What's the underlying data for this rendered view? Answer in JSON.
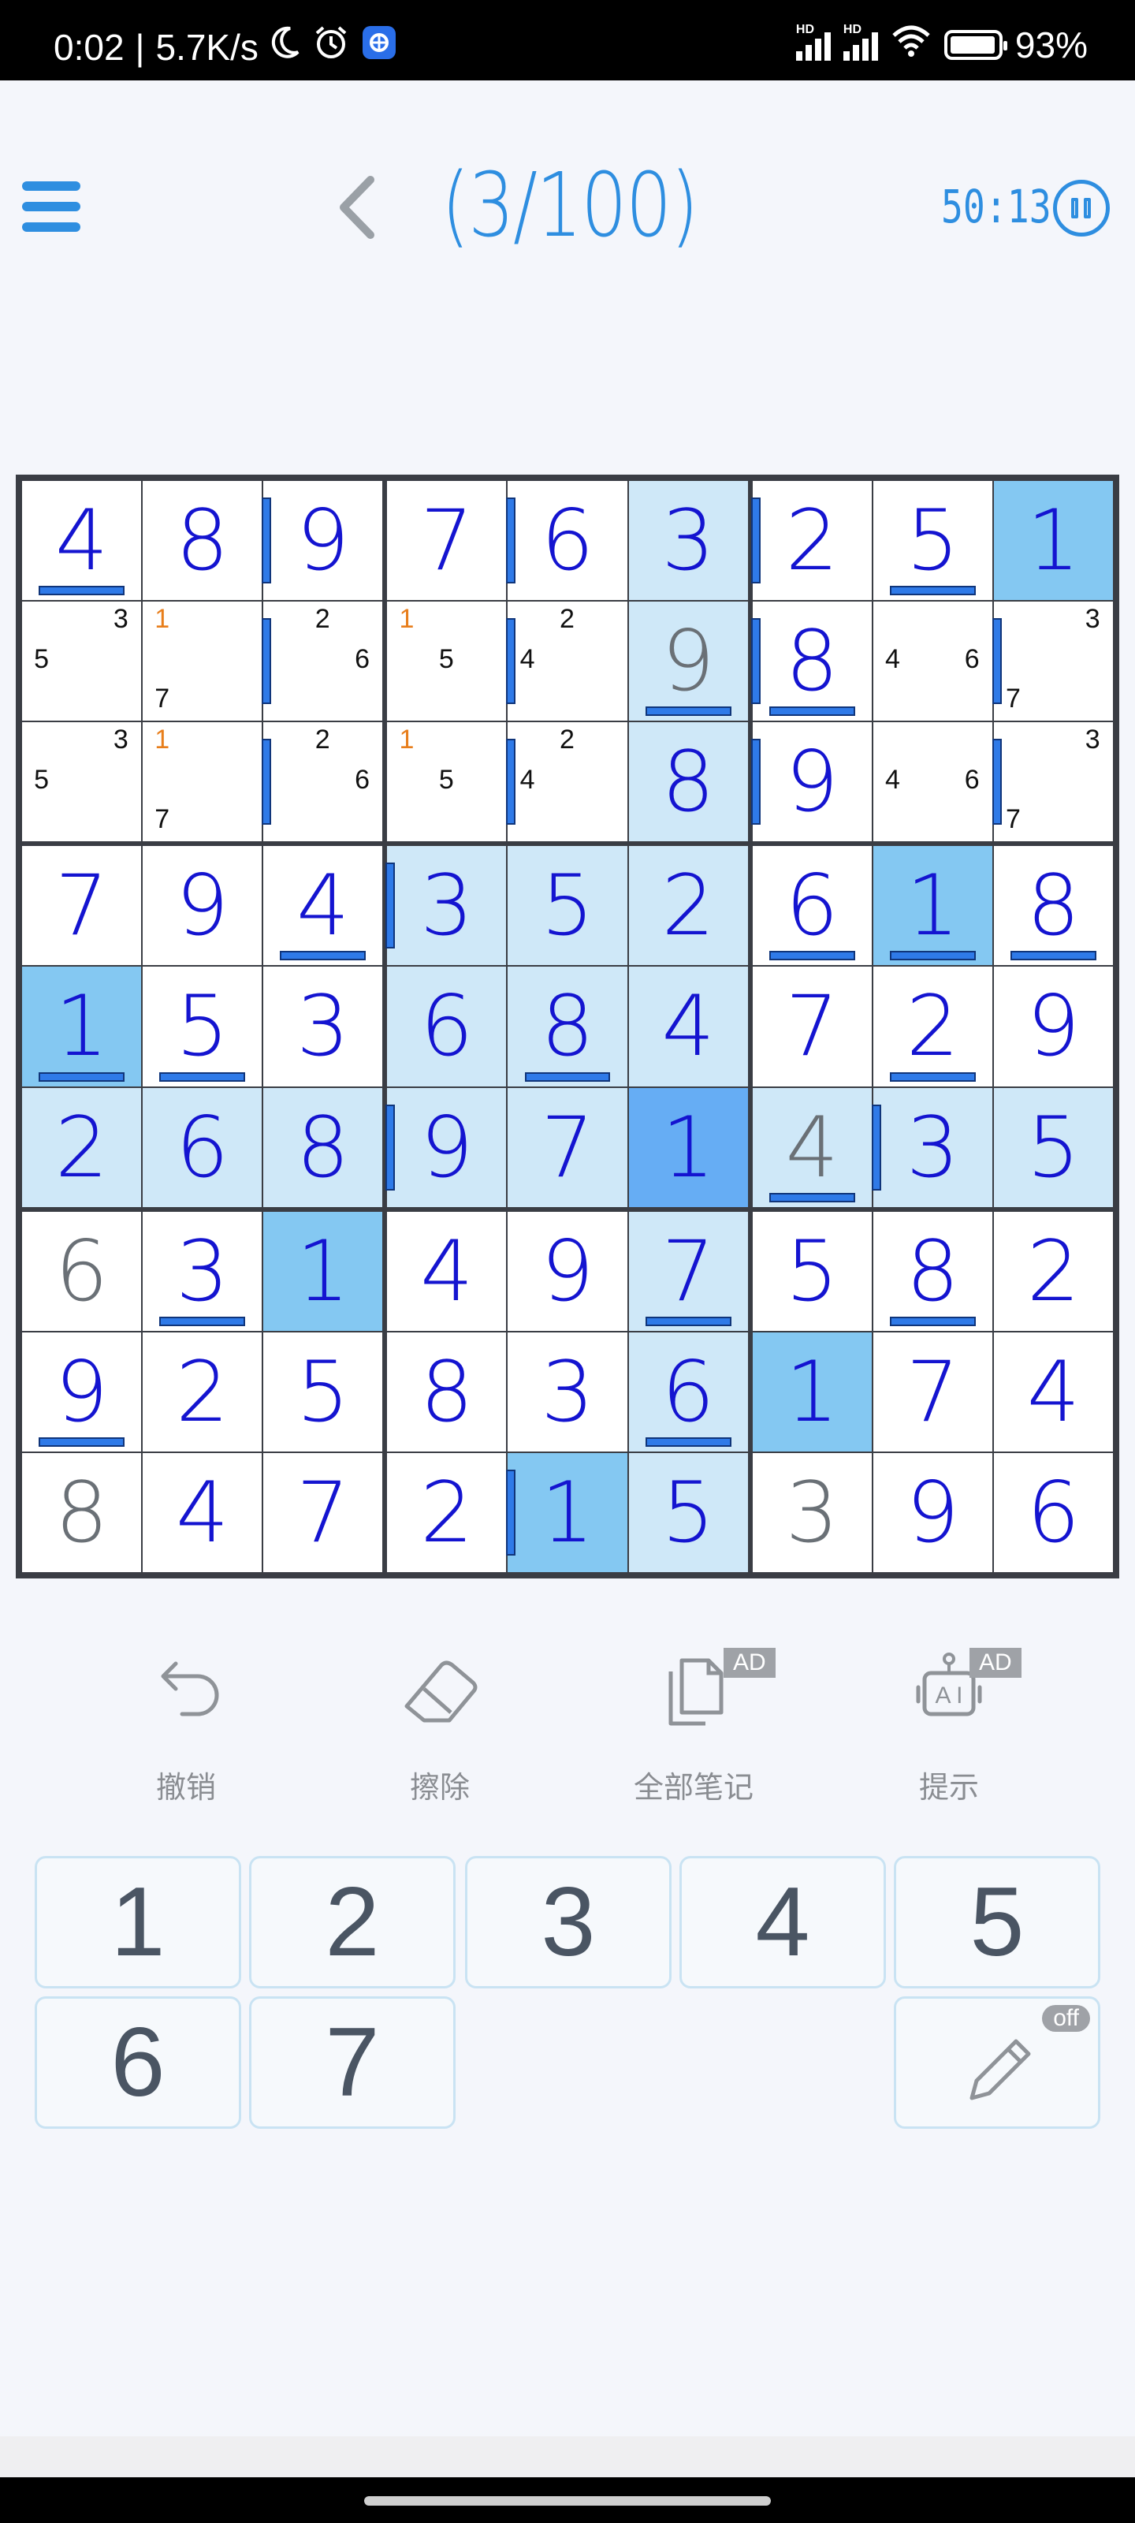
{
  "status_bar": {
    "time": "0:02",
    "net_speed": "5.7K/s",
    "battery": "93%",
    "signal_tag": "HD"
  },
  "header": {
    "title": "(3/100)",
    "timer": "50:13"
  },
  "colors": {
    "accent": "#2e8ee0",
    "user_digit": "#1414d0",
    "given_digit": "#6a7076",
    "highlight": "#cfe8f8",
    "same_number": "#84c8f2",
    "selected": "#66adf4",
    "note_orange": "#e87e1b"
  },
  "board": {
    "cells": [
      [
        "4",
        "8",
        "9",
        "7",
        "6",
        "3",
        "2",
        "5",
        "1"
      ],
      [
        "",
        "",
        "",
        "",
        "",
        "9",
        "8",
        "",
        ""
      ],
      [
        "",
        "",
        "",
        "",
        "",
        "8",
        "9",
        "",
        ""
      ],
      [
        "7",
        "9",
        "4",
        "3",
        "5",
        "2",
        "6",
        "1",
        "8"
      ],
      [
        "1",
        "5",
        "3",
        "6",
        "8",
        "4",
        "7",
        "2",
        "9"
      ],
      [
        "2",
        "6",
        "8",
        "9",
        "7",
        "1",
        "4",
        "3",
        "5"
      ],
      [
        "6",
        "3",
        "1",
        "4",
        "9",
        "7",
        "5",
        "8",
        "2"
      ],
      [
        "9",
        "2",
        "5",
        "8",
        "3",
        "6",
        "1",
        "7",
        "4"
      ],
      [
        "8",
        "4",
        "7",
        "2",
        "1",
        "5",
        "3",
        "9",
        "6"
      ]
    ],
    "given": [
      [
        1,
        5
      ],
      [
        5,
        6
      ],
      [
        6,
        0
      ],
      [
        8,
        0
      ],
      [
        8,
        6
      ]
    ],
    "highlight": [
      [
        0,
        5
      ],
      [
        1,
        5
      ],
      [
        2,
        5
      ],
      [
        3,
        3
      ],
      [
        3,
        4
      ],
      [
        3,
        5
      ],
      [
        4,
        3
      ],
      [
        4,
        4
      ],
      [
        4,
        5
      ],
      [
        5,
        0
      ],
      [
        5,
        1
      ],
      [
        5,
        2
      ],
      [
        5,
        3
      ],
      [
        5,
        4
      ],
      [
        5,
        6
      ],
      [
        5,
        7
      ],
      [
        5,
        8
      ],
      [
        6,
        5
      ],
      [
        7,
        5
      ],
      [
        8,
        5
      ]
    ],
    "same_number": [
      [
        0,
        8
      ],
      [
        3,
        7
      ],
      [
        4,
        0
      ],
      [
        6,
        2
      ],
      [
        7,
        6
      ],
      [
        8,
        4
      ]
    ],
    "selected": [
      5,
      5
    ],
    "notes": [
      {
        "r": 1,
        "c": 0,
        "items": [
          {
            "d": "3",
            "p": "tr"
          },
          {
            "d": "5",
            "p": "ml"
          }
        ]
      },
      {
        "r": 1,
        "c": 1,
        "items": [
          {
            "d": "1",
            "p": "tl",
            "o": true
          },
          {
            "d": "7",
            "p": "bl"
          }
        ]
      },
      {
        "r": 1,
        "c": 2,
        "items": [
          {
            "d": "2",
            "p": "tm"
          },
          {
            "d": "6",
            "p": "mr"
          }
        ]
      },
      {
        "r": 1,
        "c": 3,
        "items": [
          {
            "d": "1",
            "p": "tl",
            "o": true
          },
          {
            "d": "5",
            "p": "mm"
          }
        ]
      },
      {
        "r": 1,
        "c": 4,
        "items": [
          {
            "d": "2",
            "p": "tm"
          },
          {
            "d": "4",
            "p": "ml"
          }
        ]
      },
      {
        "r": 1,
        "c": 7,
        "items": [
          {
            "d": "4",
            "p": "ml"
          },
          {
            "d": "6",
            "p": "mr"
          }
        ]
      },
      {
        "r": 1,
        "c": 8,
        "items": [
          {
            "d": "3",
            "p": "tr"
          },
          {
            "d": "7",
            "p": "bl"
          }
        ]
      },
      {
        "r": 2,
        "c": 0,
        "items": [
          {
            "d": "3",
            "p": "tr"
          },
          {
            "d": "5",
            "p": "ml"
          }
        ]
      },
      {
        "r": 2,
        "c": 1,
        "items": [
          {
            "d": "1",
            "p": "tl",
            "o": true
          },
          {
            "d": "7",
            "p": "bl"
          }
        ]
      },
      {
        "r": 2,
        "c": 2,
        "items": [
          {
            "d": "2",
            "p": "tm"
          },
          {
            "d": "6",
            "p": "mr"
          }
        ]
      },
      {
        "r": 2,
        "c": 3,
        "items": [
          {
            "d": "1",
            "p": "tl",
            "o": true
          },
          {
            "d": "5",
            "p": "mm"
          }
        ]
      },
      {
        "r": 2,
        "c": 4,
        "items": [
          {
            "d": "2",
            "p": "tm"
          },
          {
            "d": "4",
            "p": "ml"
          }
        ]
      },
      {
        "r": 2,
        "c": 7,
        "items": [
          {
            "d": "4",
            "p": "ml"
          },
          {
            "d": "6",
            "p": "mr"
          }
        ]
      },
      {
        "r": 2,
        "c": 8,
        "items": [
          {
            "d": "3",
            "p": "tr"
          },
          {
            "d": "7",
            "p": "bl"
          }
        ]
      }
    ],
    "markers": [
      {
        "r": 0,
        "c": 0,
        "s": "b"
      },
      {
        "r": 0,
        "c": 2,
        "s": "l"
      },
      {
        "r": 0,
        "c": 4,
        "s": "l"
      },
      {
        "r": 0,
        "c": 6,
        "s": "l"
      },
      {
        "r": 0,
        "c": 7,
        "s": "b"
      },
      {
        "r": 1,
        "c": 2,
        "s": "l"
      },
      {
        "r": 1,
        "c": 4,
        "s": "l"
      },
      {
        "r": 1,
        "c": 5,
        "s": "b"
      },
      {
        "r": 1,
        "c": 6,
        "s": "l"
      },
      {
        "r": 1,
        "c": 6,
        "s": "b"
      },
      {
        "r": 1,
        "c": 8,
        "s": "l"
      },
      {
        "r": 2,
        "c": 2,
        "s": "l"
      },
      {
        "r": 2,
        "c": 4,
        "s": "l"
      },
      {
        "r": 2,
        "c": 6,
        "s": "l"
      },
      {
        "r": 2,
        "c": 8,
        "s": "l"
      },
      {
        "r": 3,
        "c": 2,
        "s": "b"
      },
      {
        "r": 3,
        "c": 3,
        "s": "l"
      },
      {
        "r": 3,
        "c": 6,
        "s": "b"
      },
      {
        "r": 3,
        "c": 7,
        "s": "b"
      },
      {
        "r": 3,
        "c": 8,
        "s": "b"
      },
      {
        "r": 4,
        "c": 0,
        "s": "b"
      },
      {
        "r": 4,
        "c": 1,
        "s": "b"
      },
      {
        "r": 4,
        "c": 4,
        "s": "b"
      },
      {
        "r": 4,
        "c": 7,
        "s": "b"
      },
      {
        "r": 5,
        "c": 3,
        "s": "l"
      },
      {
        "r": 5,
        "c": 6,
        "s": "b"
      },
      {
        "r": 5,
        "c": 7,
        "s": "l"
      },
      {
        "r": 6,
        "c": 1,
        "s": "b"
      },
      {
        "r": 6,
        "c": 5,
        "s": "b"
      },
      {
        "r": 6,
        "c": 7,
        "s": "b"
      },
      {
        "r": 7,
        "c": 0,
        "s": "b"
      },
      {
        "r": 7,
        "c": 5,
        "s": "b"
      },
      {
        "r": 8,
        "c": 4,
        "s": "l"
      }
    ]
  },
  "toolbar": {
    "undo_label": "撤销",
    "erase_label": "擦除",
    "all_notes_label": "全部笔记",
    "hint_label": "提示",
    "ad_badge": "AD"
  },
  "numpad": {
    "keys": [
      "1",
      "2",
      "3",
      "4",
      "5",
      "6",
      "7"
    ],
    "pencil_state": "off"
  }
}
